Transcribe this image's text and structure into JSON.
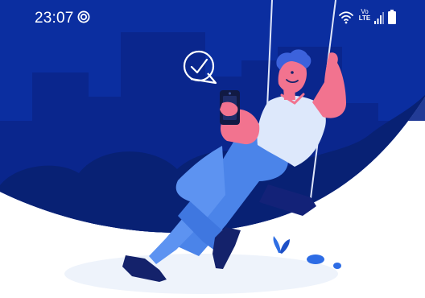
{
  "status_bar": {
    "time": "23:07",
    "network_label_top": "Vo",
    "network_label_bottom": "LTE",
    "icons": [
      "notification-circle-icon",
      "wifi-icon",
      "volte-icon",
      "signal-icon",
      "battery-icon"
    ]
  },
  "illustration": {
    "subject": "man-on-swing-with-phone",
    "icons": [
      "checkmark-speech-bubble-icon"
    ]
  },
  "colors": {
    "night_sky": "#0b2ea0",
    "skyline": "#0a268b",
    "cloud_dark": "#082174",
    "skin": "#f2738f",
    "shirt": "#dde8fb",
    "pants": "#4b84e9",
    "hair": "#3c62dc",
    "shoe": "#14226b",
    "ground": "#eef3fb"
  }
}
